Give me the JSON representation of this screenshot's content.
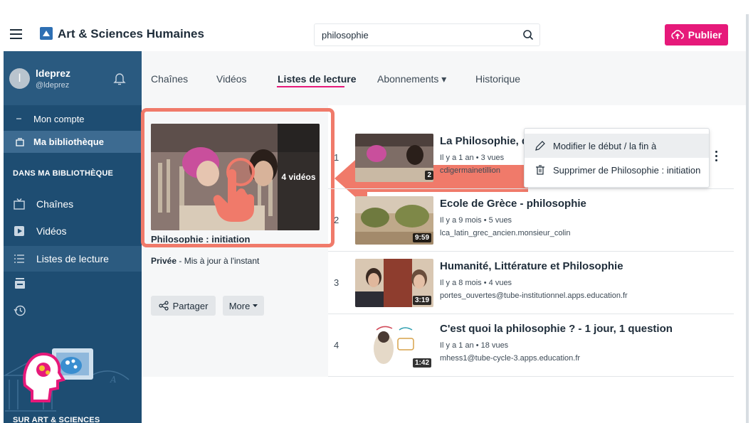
{
  "header": {
    "app_title": "Art & Sciences Humaines",
    "search_value": "philosophie",
    "publish_label": "Publier",
    "accent_color": "#e6197a"
  },
  "sidebar": {
    "user": {
      "initial": "l",
      "name": "ldeprez",
      "handle": "@ldeprez"
    },
    "account_items": [
      {
        "label": "Mon compte",
        "icon": "user-icon"
      },
      {
        "label": "Ma bibliothèque",
        "icon": "library-icon"
      }
    ],
    "library_section": "DANS MA BIBLIOTHÈQUE",
    "library_items": [
      {
        "label": "Chaînes",
        "icon": "channels-icon"
      },
      {
        "label": "Vidéos",
        "icon": "videos-icon"
      },
      {
        "label": "Listes de lecture",
        "icon": "playlist-icon"
      }
    ],
    "footer_section": "SUR ART & SCIENCES HUMAINES"
  },
  "tabs": [
    {
      "label": "Chaînes"
    },
    {
      "label": "Vidéos"
    },
    {
      "label": "Listes de lecture",
      "active": true
    },
    {
      "label": "Abonnements ▾"
    },
    {
      "label": "Historique"
    }
  ],
  "playlist": {
    "video_count": "4 vidéos",
    "title": "Philosophie : initiation",
    "privacy": "Privée",
    "privacy_detail": " - Mis à jour à l'instant",
    "share_label": "Partager",
    "more_label": "More"
  },
  "videos": [
    {
      "index": "1",
      "title": "La Philosophie, qu",
      "meta": "Il y a 1 an • 3 vues",
      "channel": "cdigermainetillion",
      "duration": "2"
    },
    {
      "index": "2",
      "title": "Ecole de Grèce - philosophie",
      "meta": "Il y a 9 mois • 5 vues",
      "channel": "lca_latin_grec_ancien.monsieur_colin",
      "duration": "9:59"
    },
    {
      "index": "3",
      "title": "Humanité, Littérature et Philosophie",
      "meta": "Il y a 8 mois • 4 vues",
      "channel": "portes_ouvertes@tube-institutionnel.apps.education.fr",
      "duration": "3:19"
    },
    {
      "index": "4",
      "title": "C'est quoi la philosophie ? - 1 jour, 1 question",
      "meta": "Il y a 1 an • 18 vues",
      "channel": "mhess1@tube-cycle-3.apps.education.fr",
      "duration": "1:42"
    }
  ],
  "context_menu": {
    "edit_label": "Modifier le début / la fin à",
    "delete_label": "Supprimer de Philosophie : initiation"
  }
}
